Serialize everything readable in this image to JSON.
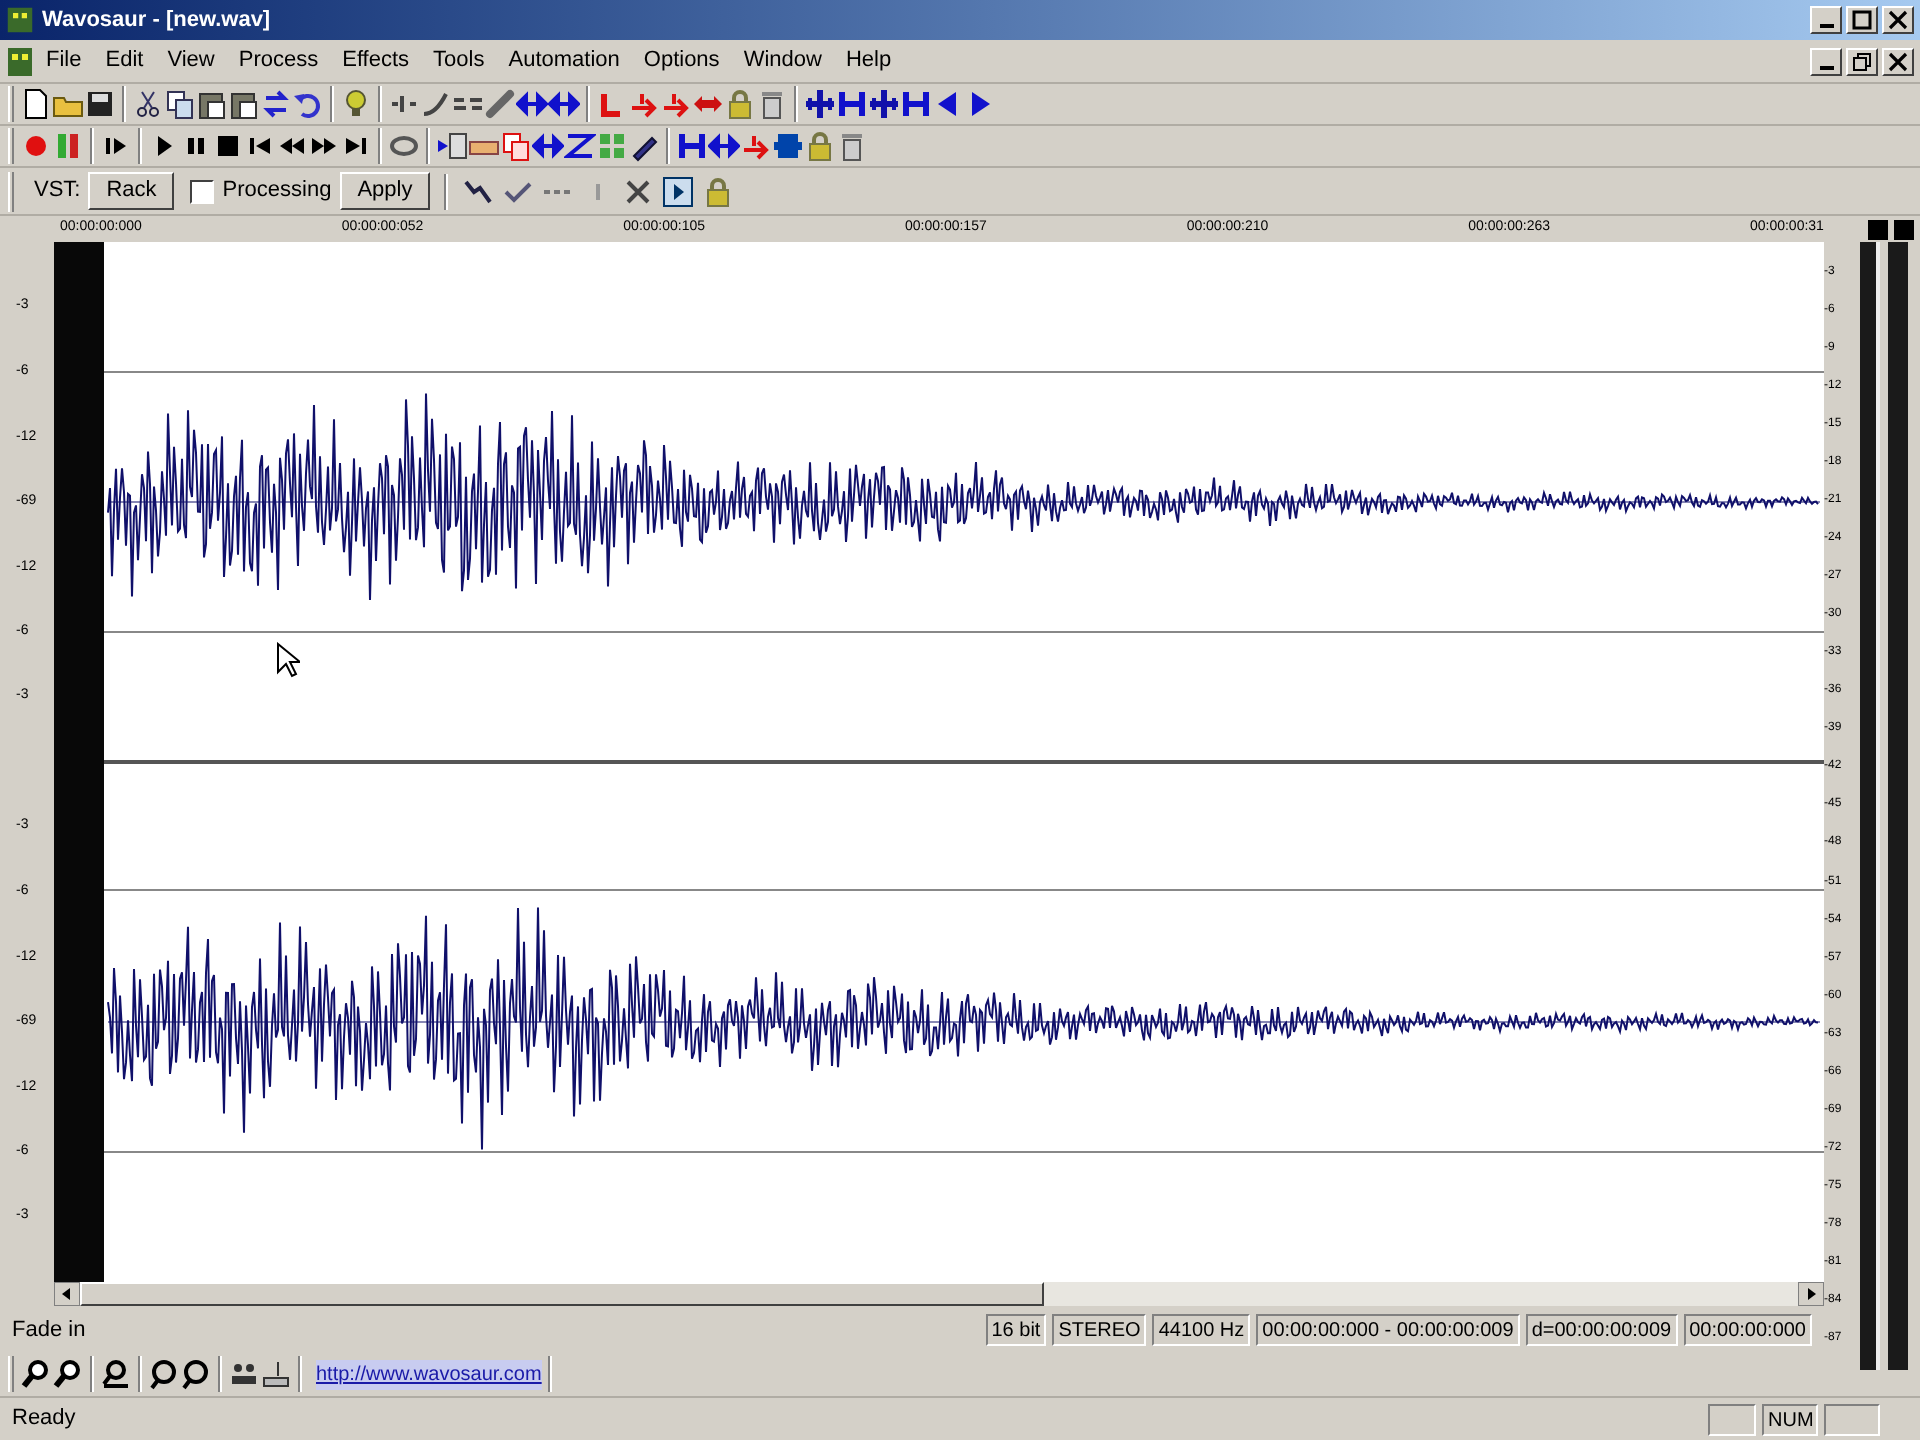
{
  "window": {
    "title": "Wavosaur - [new.wav]"
  },
  "menu": [
    "File",
    "Edit",
    "View",
    "Process",
    "Effects",
    "Tools",
    "Automation",
    "Options",
    "Window",
    "Help"
  ],
  "vst_bar": {
    "label": "VST:",
    "rack_button": "Rack",
    "processing": {
      "label": "Processing",
      "checked": false
    },
    "apply_button": "Apply"
  },
  "ruler": [
    "00:00:00:000",
    "00:00:00:052",
    "00:00:00:105",
    "00:00:00:157",
    "00:00:00:210",
    "00:00:00:263",
    "00:00:00:31"
  ],
  "channels": [
    {
      "scale": [
        "-3",
        "-6",
        "-12",
        "-69",
        "-12",
        "-6",
        "-3"
      ]
    },
    {
      "scale": [
        "-3",
        "-6",
        "-12",
        "-69",
        "-12",
        "-6",
        "-3"
      ]
    }
  ],
  "meter_scale": [
    "-3",
    "-6",
    "-9",
    "-12",
    "-15",
    "-18",
    "-21",
    "-24",
    "-27",
    "-30",
    "-33",
    "-36",
    "-39",
    "-42",
    "-45",
    "-48",
    "-51",
    "-54",
    "-57",
    "-60",
    "-63",
    "-66",
    "-69",
    "-72",
    "-75",
    "-78",
    "-81",
    "-84",
    "-87"
  ],
  "info": {
    "status_text": "Fade in",
    "cells": [
      "16 bit",
      "STEREO",
      "44100 Hz",
      "00:00:00:000 - 00:00:00:009",
      "d=00:00:00:009",
      "00:00:00:000"
    ]
  },
  "link": "http://www.wavosaur.com",
  "status_bar": {
    "text": "Ready",
    "num_lock": "NUM"
  }
}
